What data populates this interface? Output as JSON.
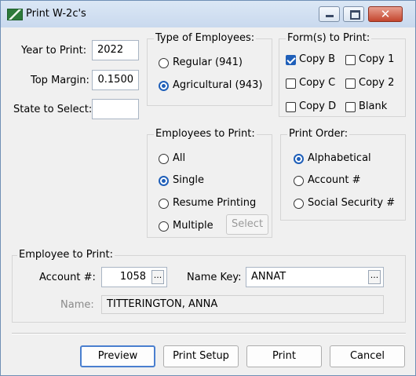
{
  "window": {
    "title": "Print W-2c's",
    "close_symbol": "✕"
  },
  "top_fields": {
    "year_label": "Year to Print:",
    "year_value": "2022",
    "margin_label": "Top Margin:",
    "margin_value": "0.1500",
    "state_label": "State to Select:",
    "state_value": ""
  },
  "type_of_employees": {
    "title": "Type of Employees:",
    "options": [
      "Regular (941)",
      "Agricultural (943)"
    ],
    "selected": "Agricultural (943)"
  },
  "forms_to_print": {
    "title": "Form(s) to Print:",
    "options": [
      {
        "label": "Copy B",
        "checked": true
      },
      {
        "label": "Copy 1",
        "checked": false
      },
      {
        "label": "Copy C",
        "checked": false
      },
      {
        "label": "Copy 2",
        "checked": false
      },
      {
        "label": "Copy D",
        "checked": false
      },
      {
        "label": "Blank",
        "checked": false
      }
    ]
  },
  "employees_to_print": {
    "title": "Employees to Print:",
    "options": [
      "All",
      "Single",
      "Resume Printing",
      "Multiple"
    ],
    "selected": "Single",
    "select_button": "Select"
  },
  "print_order": {
    "title": "Print Order:",
    "options": [
      "Alphabetical",
      "Account #",
      "Social Security #"
    ],
    "selected": "Alphabetical"
  },
  "employee_to_print": {
    "title": "Employee to Print:",
    "account_label": "Account #:",
    "account_value": "1058",
    "namekey_label": "Name Key:",
    "namekey_value": "ANNAT",
    "name_label": "Name:",
    "name_value": "TITTERINGTON, ANNA",
    "lookup_symbol": "..."
  },
  "buttons": {
    "preview": "Preview",
    "print_setup": "Print Setup",
    "print": "Print",
    "cancel": "Cancel"
  }
}
